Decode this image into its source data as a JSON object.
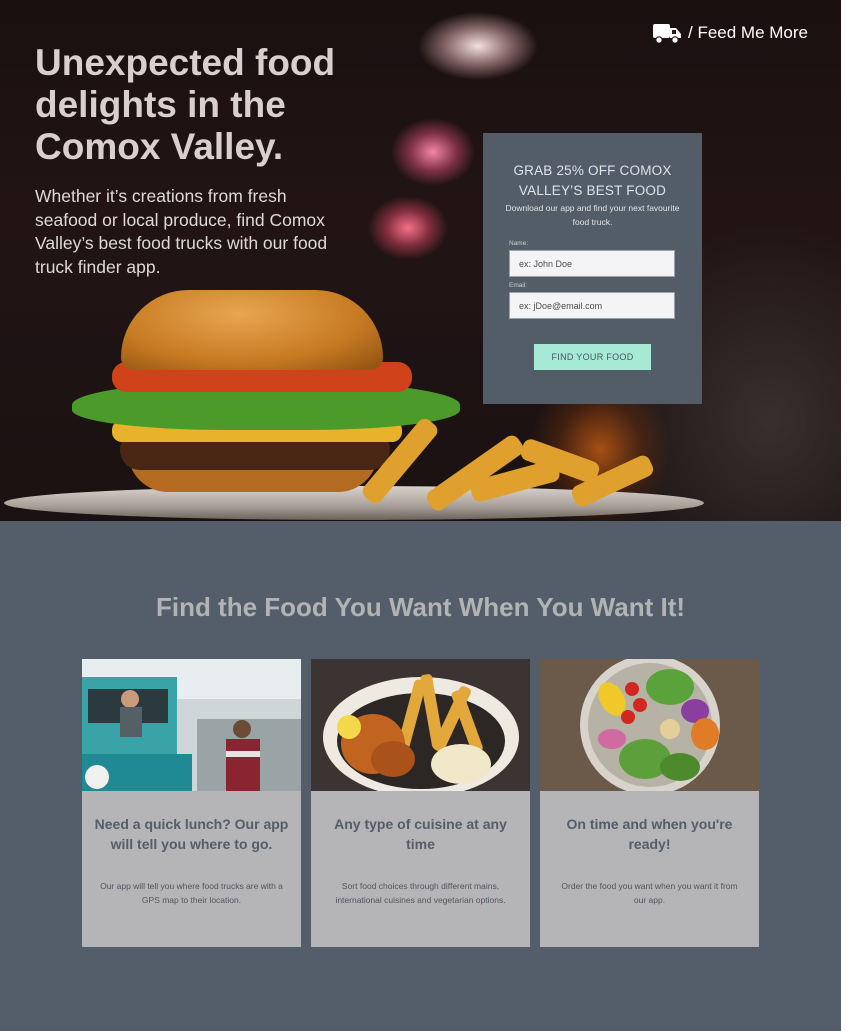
{
  "brand": {
    "name": "/ Feed Me More",
    "icon": "truck-icon"
  },
  "hero": {
    "title": "Unexpected food delights in the Comox Valley.",
    "subtitle": "Whether it’s creations from fresh seafood or local produce, find Comox Valley’s best food trucks with our food truck finder app."
  },
  "signup": {
    "title": "GRAB 25% OFF COMOX VALLEY’S BEST FOOD",
    "description": "Download our app and find your next favourite food truck.",
    "name_label": "Name:",
    "name_placeholder": "ex: John Doe",
    "email_label": "Email:",
    "email_placeholder": "ex: jDoe@email.com",
    "button_label": "FIND YOUR FOOD"
  },
  "section": {
    "title": "Find the Food You Want When You Want It!",
    "cards": [
      {
        "title": "Need a quick lunch? Our app will tell you where to go.",
        "description": "Our app will tell you where food trucks are with a GPS map to their location.",
        "image": "food-truck-photo"
      },
      {
        "title": "Any type of cuisine at any time",
        "description": "Sort food choices through different mains, international cuisines and vegetarian options.",
        "image": "fried-chicken-fries-photo"
      },
      {
        "title": "On time and when you're ready!",
        "description": "Order the food you want when you want it from our app.",
        "image": "salad-bowl-photo"
      }
    ]
  },
  "colors": {
    "hero_bg": "#1a1010",
    "card_panel": "#525d68",
    "cta": "#a6ead6",
    "section_bg": "#545e6a",
    "card_bg": "#b5b4b6"
  }
}
